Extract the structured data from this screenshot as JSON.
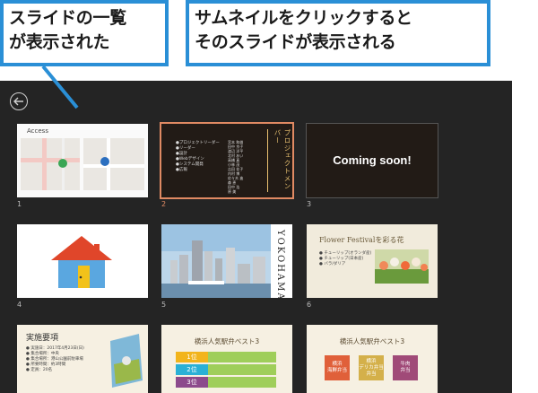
{
  "callouts": {
    "left": "スライドの一覧\nが表示された",
    "right": "サムネイルをクリックすると\nそのスライドが表示される"
  },
  "viewer": {
    "back_icon": "back-arrow-icon",
    "thumbnails": [
      {
        "number": "1",
        "title": "Access"
      },
      {
        "number": "2",
        "title": "プロジェクトメンバー",
        "selected": true,
        "left_col": "●プロジェクトリーダー\n●リーダー\n●設計\n●Webデザイン\n●システム開発\n●広報",
        "mid_col": "宮本 和雄\n田中 京子\n渡辺 洋平\n北村 あい\n高橋 真\n小林 茂\n吉田 花子\n内村 博\n佐々木 進\n森 恵\n田中 浩\n原 美"
      },
      {
        "number": "3",
        "text": "Coming soon!"
      },
      {
        "number": "4"
      },
      {
        "number": "5",
        "vertical_text": "YOKOHAMA"
      },
      {
        "number": "6",
        "title": "Flower Festivalを彩る花",
        "bullets": "● チューリップ(オランダ産)\n● チューリップ(日本産)\n● バラ/ダリア"
      },
      {
        "number": "",
        "title": "実施要項",
        "bullets": "● 実施日：2017年4月23日(日)\n● 集合場所：中央\n● 集合場所：港山公園前駐車場\n● 所要時間：約3時間\n● 定員：20名"
      },
      {
        "number": "",
        "title": "横浜人気駅弁ベスト3",
        "ranks": [
          "1位",
          "2位",
          "3位"
        ]
      },
      {
        "number": "",
        "title": "横浜人気駅弁ベスト3",
        "boxes": [
          "横浜\n海鮮弁当",
          "横浜\nデリカ弁当\n弁当",
          "牛肉\n弁当"
        ]
      }
    ]
  },
  "colors": {
    "callout_border": "#2a8fd6",
    "viewer_bg": "#242424",
    "selection": "#e08a63"
  }
}
